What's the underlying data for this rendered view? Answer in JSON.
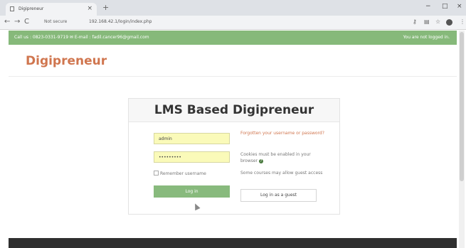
{
  "browser": {
    "tab_title": "Digipreneur",
    "tab_close": "×",
    "new_tab": "+",
    "security_label": "Not secure",
    "url": "192.168.42.1/login/index.php",
    "win_minimize": "−",
    "win_maximize": "□",
    "win_close": "×",
    "back": "←",
    "forward": "→",
    "reload": "C"
  },
  "topbar": {
    "contact": "Call us : 0823-0331-9719 ✉ E-mail : fadil.cancer96@gmail.com",
    "login_status": "You are not logged in."
  },
  "site": {
    "brand": "Digipreneur"
  },
  "login": {
    "title": "LMS Based Digipreneur",
    "username_value": "admin",
    "password_value": "•••••••••",
    "remember_label": "Remember username",
    "login_button": "Log in",
    "forgot_link": "Forgotten your username or password?",
    "cookies_note": "Cookies must be enabled in your browser",
    "guest_note": "Some courses may allow guest access",
    "guest_button": "Log in as a guest"
  },
  "colors": {
    "accent_green": "#86b97a",
    "brand_orange": "#d0764f",
    "field_yellow": "#fafab9",
    "footer_dark": "#2f2f2f"
  }
}
